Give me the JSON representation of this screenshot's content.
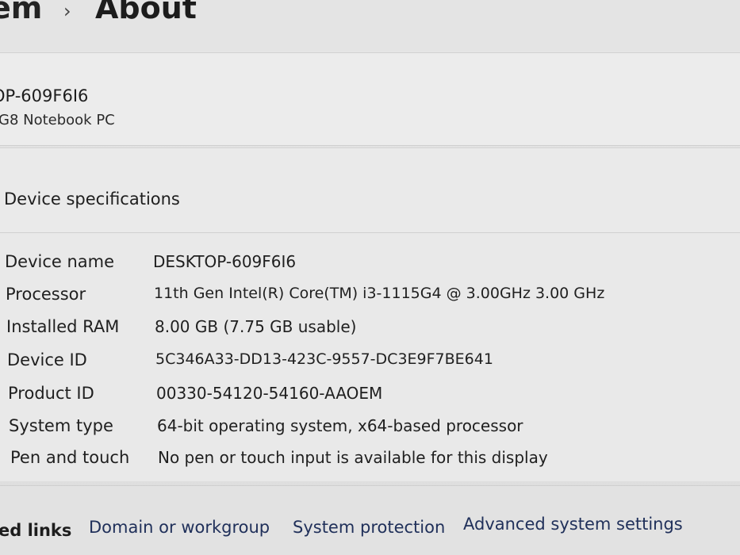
{
  "breadcrumb": {
    "parent": "em",
    "separator": "›",
    "current": "About"
  },
  "device": {
    "hostname": "OP-609F6I6",
    "model": "G8 Notebook PC"
  },
  "specs": {
    "title": "Device specifications",
    "rows": [
      {
        "label": "Device name",
        "value": "DESKTOP-609F6I6"
      },
      {
        "label": "Processor",
        "value": "11th Gen Intel(R) Core(TM) i3-1115G4 @ 3.00GHz   3.00 GHz"
      },
      {
        "label": "Installed RAM",
        "value": "8.00 GB (7.75 GB usable)"
      },
      {
        "label": "Device ID",
        "value": "5C346A33-DD13-423C-9557-DC3E9F7BE641"
      },
      {
        "label": "Product ID",
        "value": "00330-54120-54160-AAOEM"
      },
      {
        "label": "System type",
        "value": "64-bit operating system, x64-based processor"
      },
      {
        "label": "Pen and touch",
        "value": "No pen or touch input is available for this display"
      }
    ]
  },
  "related_links": {
    "label": "ed links",
    "links": [
      "Domain or workgroup",
      "System protection",
      "Advanced system settings"
    ]
  }
}
